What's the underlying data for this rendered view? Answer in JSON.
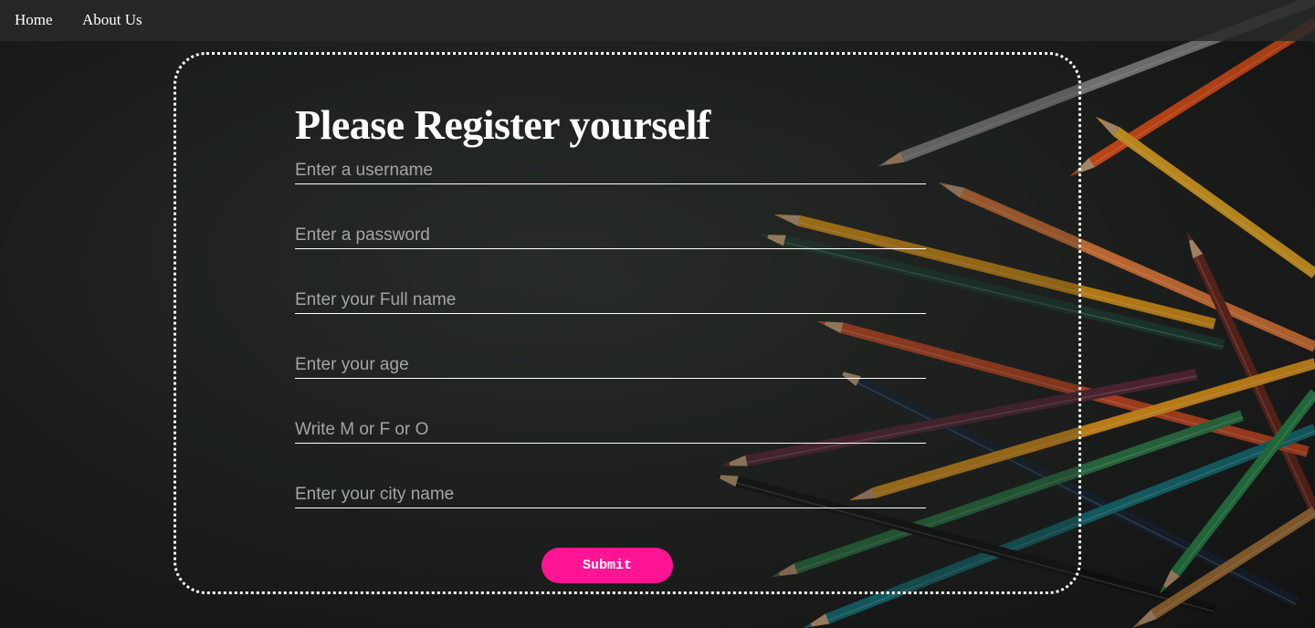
{
  "nav": {
    "home": "Home",
    "about": "About Us"
  },
  "form": {
    "title": "Please Register yourself",
    "fields": [
      {
        "placeholder": "Enter a username"
      },
      {
        "placeholder": "Enter a password"
      },
      {
        "placeholder": "Enter your Full name"
      },
      {
        "placeholder": "Enter your age"
      },
      {
        "placeholder": "Write M or F or O"
      },
      {
        "placeholder": "Enter your city name"
      }
    ],
    "submit_label": "Submit"
  },
  "colors": {
    "submit_bg": "#ff1493",
    "background": "#232624",
    "text": "#ffffff"
  }
}
